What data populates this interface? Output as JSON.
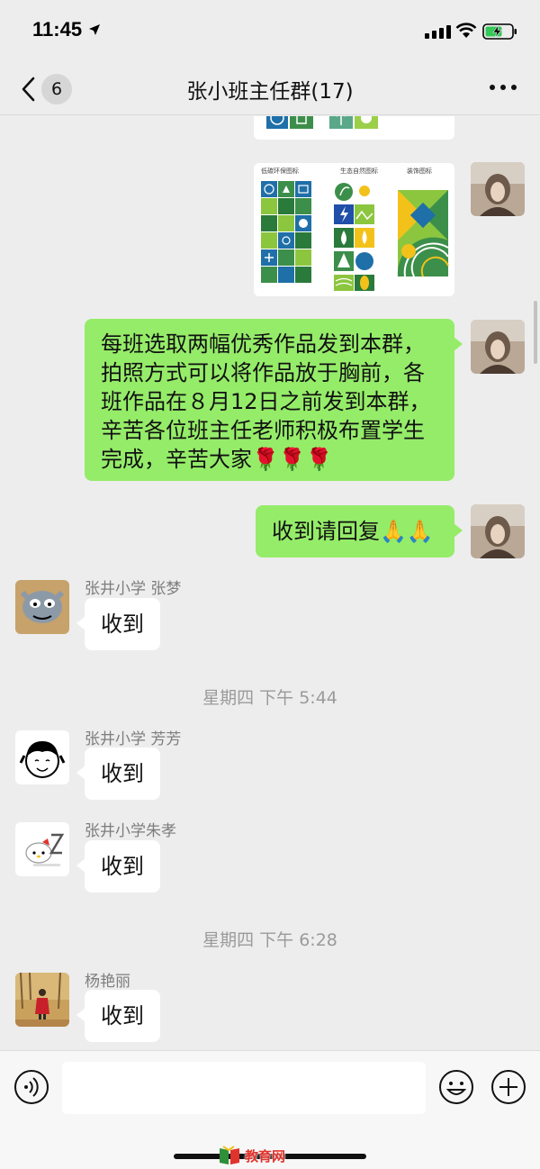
{
  "status_bar": {
    "time": "11:45",
    "icons": [
      "location-arrow-icon",
      "signal-icon",
      "wifi-icon",
      "battery-charging-icon"
    ]
  },
  "nav": {
    "unread_count": "6",
    "title": "张小班主任群(17)",
    "icons": [
      "chevron-left-icon",
      "more-icon"
    ]
  },
  "images": {
    "poster_headings": [
      "低碳环保图标",
      "生态自然图标",
      "装饰图标"
    ]
  },
  "messages": [
    {
      "side": "right",
      "type": "text",
      "lines": [
        "每班选取两幅优秀作品发到本群，",
        "拍照方式可以将作品放于胸前，各",
        "班作品在８月12日之前发到本群，",
        "辛苦各位班主任老师积极布置学生",
        "完成，辛苦大家🌹🌹🌹"
      ]
    },
    {
      "side": "right",
      "type": "text",
      "text": "收到请回复🙏🙏"
    },
    {
      "side": "left",
      "sender": "张井小学 张梦",
      "text": "收到"
    },
    {
      "side": "left",
      "sender": "张井小学 芳芳",
      "text": "收到"
    },
    {
      "side": "left",
      "sender": "张井小学朱孝",
      "text": "收到"
    },
    {
      "side": "left",
      "sender": "杨艳丽",
      "text": "收到"
    }
  ],
  "timestamps": [
    "星期四 下午 5:44",
    "星期四 下午 6:28"
  ],
  "input_bar": {
    "placeholder": "",
    "icons": [
      "voice-icon",
      "emoji-icon",
      "plus-icon"
    ]
  },
  "watermark": "教育网",
  "colors": {
    "background": "#ededed",
    "sent_bubble": "#95ec69",
    "received_bubble": "#ffffff"
  }
}
